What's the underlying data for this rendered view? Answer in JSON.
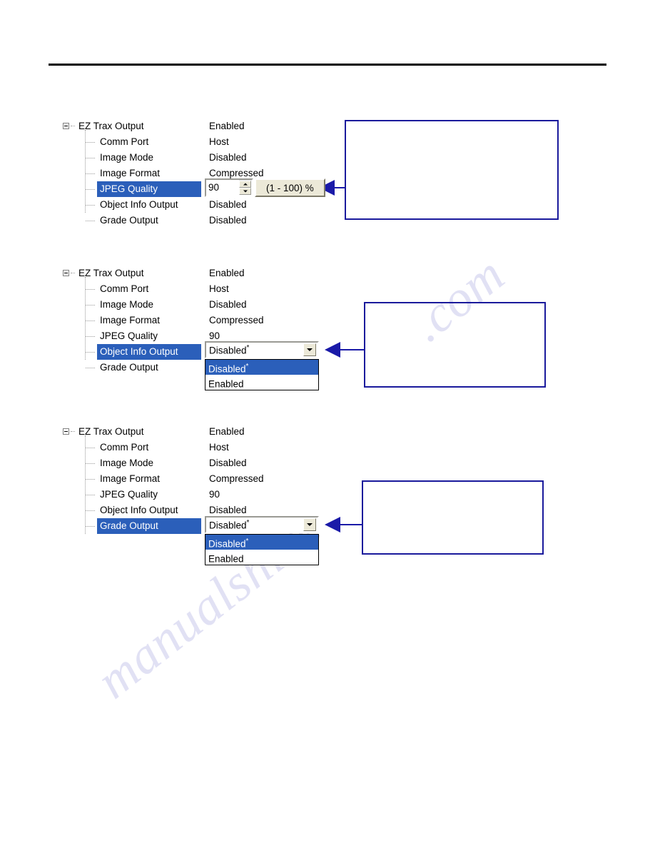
{
  "document": {
    "header_rule": true
  },
  "watermark": {
    "text_a": ".com",
    "text_b": "manualshive"
  },
  "tree": {
    "root_label": "EZ Trax Output",
    "root_value": "Enabled",
    "rows": [
      {
        "label": "Comm Port",
        "value": "Host"
      },
      {
        "label": "Image Mode",
        "value": "Disabled"
      },
      {
        "label": "Image Format",
        "value": "Compressed"
      },
      {
        "label": "JPEG Quality",
        "value": "90"
      },
      {
        "label": "Object Info Output",
        "value": "Disabled"
      },
      {
        "label": "Grade Output",
        "value": "Disabled"
      }
    ]
  },
  "panels": [
    {
      "id": "panel-1",
      "selected_row": "JPEG Quality",
      "control": "spinner",
      "spinner": {
        "value": "90",
        "up_icon": "triangle-up-icon",
        "down_icon": "triangle-down-icon"
      },
      "range_hint": "(1 - 100) %",
      "callout": {
        "text": ""
      }
    },
    {
      "id": "panel-2",
      "selected_row": "Object Info Output",
      "control": "combobox",
      "combo": {
        "selected": "Disabled",
        "selected_marker": "*",
        "button_icon": "chevron-down-icon",
        "options": [
          {
            "label": "Disabled",
            "marker": "*",
            "selected": true
          },
          {
            "label": "Enabled",
            "marker": "",
            "selected": false
          }
        ]
      },
      "callout": {
        "text": ""
      }
    },
    {
      "id": "panel-3",
      "selected_row": "Grade Output",
      "control": "combobox",
      "combo": {
        "selected": "Disabled",
        "selected_marker": "*",
        "button_icon": "chevron-down-icon",
        "options": [
          {
            "label": "Disabled",
            "marker": "*",
            "selected": true
          },
          {
            "label": "Enabled",
            "marker": "",
            "selected": false
          }
        ]
      },
      "callout": {
        "text": ""
      }
    }
  ],
  "colors": {
    "selection_blue": "#2b5fba",
    "callout_blue": "#1a1a9c",
    "arrow_blue": "#1a1aa8",
    "control_face": "#ece9d8"
  }
}
